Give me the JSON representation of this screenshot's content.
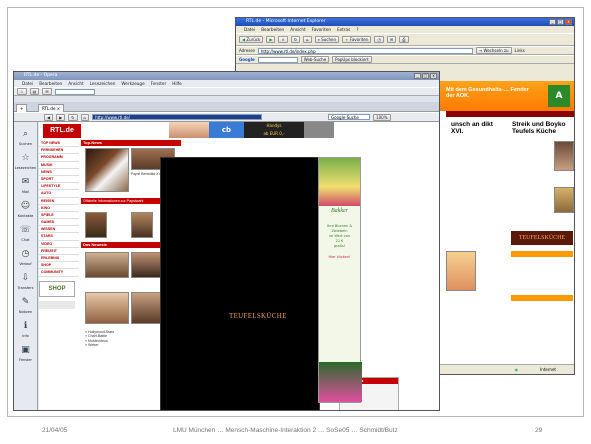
{
  "footer": {
    "date": "21/04/05",
    "center": "LMU München … Mensch-Maschine-Interaktion 2 … SoSe05 … Schmidt/Butz",
    "page": "29"
  },
  "ie_window": {
    "title": "RTL.de - Microsoft Internet Explorer",
    "menu": [
      "Datei",
      "Bearbeiten",
      "Ansicht",
      "Favoriten",
      "Extras",
      "?"
    ],
    "toolbar_back": "Zurück",
    "toolbar_search": "Suchen",
    "toolbar_favorites": "Favoriten",
    "address_label": "Adresse",
    "address_value": "http://www.rtl.de/index.php",
    "go_label": "Wechseln zu",
    "links_label": "Links",
    "google_label": "Google",
    "google_search": "Web-Suche",
    "blocked_label": "PopUps blockiert",
    "headline_banner": "Mit dem Gesundheits-… Fender der AOK.",
    "col1_headline": "unsch an dikt XVI.",
    "col2_headline": "Streik und Boyko Teufels Küche",
    "status_text": "Internet"
  },
  "opera_window": {
    "title": "RTL.de - Opera",
    "menu": [
      "Datei",
      "Bearbeiten",
      "Ansicht",
      "Lesezeichen",
      "Werkzeuge",
      "Fenster",
      "Hilfe"
    ],
    "tab_label": "RTL.de",
    "search_placeholder": "Google-Suche",
    "zoom": "100%",
    "sidebar": [
      "Suchen",
      "Lesezeichen",
      "Mail",
      "Kontakte",
      "Chat",
      "Verlauf",
      "Transfers",
      "Notizen",
      "Info",
      "Fenster"
    ]
  },
  "rtl_page": {
    "logo": "RTL.de",
    "nav": [
      "TOP NEWS",
      "FERNSEHEN",
      "PROGRAMM",
      "MUSIK",
      "NEWS",
      "SPORT",
      "LIFESTYLE",
      "AUTO",
      "REISEN",
      "KINO",
      "SPIELE",
      "GAMES",
      "WISSEN",
      "STARS",
      "VIDEO",
      "FREIZEIT",
      "ERLEBNIS",
      "SHOP",
      "COMMUNITY"
    ],
    "ad_brand": "Bakker",
    "popup_logo": "TEUFELSKÜCHE",
    "shop_label": "SHOP",
    "red_header_1": "Top-News",
    "red_header_2": "Das Neueste",
    "ticker": "Offizielle Informationen zur Papstwahl"
  }
}
